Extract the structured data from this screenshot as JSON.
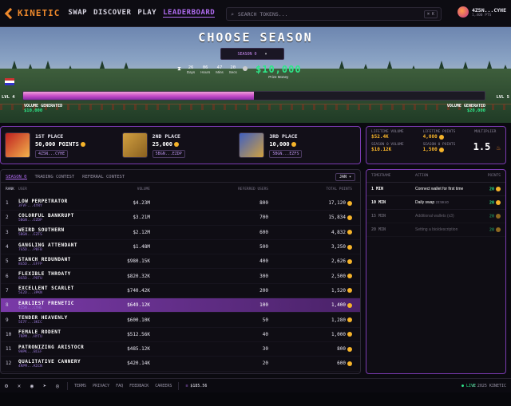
{
  "header": {
    "logo": "KINETIC",
    "nav": [
      "SWAP",
      "DISCOVER",
      "PLAY",
      "LEADERBOARD"
    ],
    "active_nav": "LEADERBOARD",
    "search_placeholder": "SEARCH TOKENS...",
    "search_shortcut": "⌘ K",
    "user_name": "4Z5N...CYHE",
    "user_points": "1,400 PTS"
  },
  "hero": {
    "title": "CHOOSE SEASON",
    "season_select": "SEASON 0",
    "countdown": [
      {
        "value": "26",
        "label": "Days"
      },
      {
        "value": "06",
        "label": "Hours"
      },
      {
        "value": "47",
        "label": "Mins"
      },
      {
        "value": "20",
        "label": "Secs"
      }
    ],
    "prize_value": "$10,000",
    "prize_label": "Prize Money",
    "level_left": "LVL 4",
    "level_right": "LVL 5",
    "progress_fraction": 0.5,
    "volume_left_label": "VOLUME GENERATED",
    "volume_left_value": "$10,000",
    "volume_right_label": "VOLUME GENERATED",
    "volume_right_value": "$20,000"
  },
  "podium": [
    {
      "place": "1ST PLACE",
      "points": "50,000 POINTS",
      "addr": "4Z5N...CYHE"
    },
    {
      "place": "2ND PLACE",
      "points": "25,000",
      "addr": "5BGN...EZDP"
    },
    {
      "place": "3RD PLACE",
      "points": "10,000",
      "addr": "5BGN...EZFS"
    }
  ],
  "stats": {
    "lifetime_volume_label": "LIFETIME VOLUME",
    "lifetime_volume": "$52.4K",
    "lifetime_points_label": "LIFETIME POINTS",
    "lifetime_points": "4,000",
    "multiplier_label": "MULTIPLIER",
    "multiplier": "1.5",
    "season_volume_label": "SEASON 0 VOLUME",
    "season_volume": "$10.12K",
    "season_points_label": "SEASON 0 POINTS",
    "season_points": "1,500"
  },
  "leaderboard": {
    "tabs": [
      "SEASON 0",
      "TRADING CONTEST",
      "REFERRAL CONTEST"
    ],
    "month": "JAN",
    "columns": [
      "RANK",
      "USER",
      "VOLUME",
      "REFERRED USERS",
      "TOTAL POINTS"
    ],
    "rows": [
      {
        "rank": "1",
        "name": "LOW PERPETRATOR",
        "addr": "3FVF...4YRY",
        "vol": "$4.23M",
        "ref": "800",
        "pts": "17,120"
      },
      {
        "rank": "2",
        "name": "COLORFUL BANKRUPT",
        "addr": "5BGN...EZDP",
        "vol": "$3.21M",
        "ref": "700",
        "pts": "15,834"
      },
      {
        "rank": "3",
        "name": "WEIRD SOUTHERN",
        "addr": "5BGN...EZFS",
        "vol": "$2.12M",
        "ref": "600",
        "pts": "4,832"
      },
      {
        "rank": "4",
        "name": "GANGLING ATTENDANT",
        "addr": "7G5D...P8FB",
        "vol": "$1.48M",
        "ref": "500",
        "pts": "3,250"
      },
      {
        "rank": "5",
        "name": "STANCH REDUNDANT",
        "addr": "8G5D...EFFP",
        "vol": "$980.15K",
        "ref": "400",
        "pts": "2,626"
      },
      {
        "rank": "6",
        "name": "FLEXIBLE THROATY",
        "addr": "8G5D...POTU",
        "vol": "$820.32K",
        "ref": "300",
        "pts": "2,500"
      },
      {
        "rank": "7",
        "name": "EXCELLENT SCARLET",
        "addr": "5E2D...3PKN",
        "vol": "$740.42K",
        "ref": "200",
        "pts": "1,520"
      },
      {
        "rank": "8",
        "name": "EARLIEST FRENETIC",
        "addr": "4Z5N...CYHE",
        "vol": "$649.12K",
        "ref": "100",
        "pts": "1,400",
        "me": true
      },
      {
        "rank": "9",
        "name": "TENDER HEAVENLY",
        "addr": "5E7F...3KIC",
        "vol": "$600.10K",
        "ref": "50",
        "pts": "1,280"
      },
      {
        "rank": "10",
        "name": "FEMALE RODENT",
        "addr": "7RPM...HYTU",
        "vol": "$512.56K",
        "ref": "40",
        "pts": "1,000"
      },
      {
        "rank": "11",
        "name": "PATRONIZING ARISTOCR",
        "addr": "9HPK...BCEF",
        "vol": "$485.12K",
        "ref": "30",
        "pts": "800"
      },
      {
        "rank": "12",
        "name": "QUALITATIVE CANNERY",
        "addr": "4RPM...KICN",
        "vol": "$420.14K",
        "ref": "20",
        "pts": "600"
      }
    ]
  },
  "activity": {
    "columns": [
      "TIMEFRAME",
      "ACTION",
      "POINTS"
    ],
    "items": [
      {
        "time": "1 MIN",
        "action": "Connect wallet for first time",
        "sub": "",
        "pts": "20",
        "done": false
      },
      {
        "time": "10 MIN",
        "action": "Daily swap",
        "sub": "23:59:40",
        "pts": "20",
        "done": false
      },
      {
        "time": "15 MIN",
        "action": "Additional wallets (x3)",
        "sub": "",
        "pts": "20",
        "done": true
      },
      {
        "time": "20 MIN",
        "action": "Setting a bio/description",
        "sub": "",
        "pts": "20",
        "done": true
      }
    ]
  },
  "footer": {
    "links": [
      "TERMS",
      "PRIVACY",
      "FAQ",
      "FEEDBACK",
      "CAREERS"
    ],
    "price": "$185.56",
    "live": "● LIVE",
    "copyright": "© 2025 KINETIC"
  }
}
